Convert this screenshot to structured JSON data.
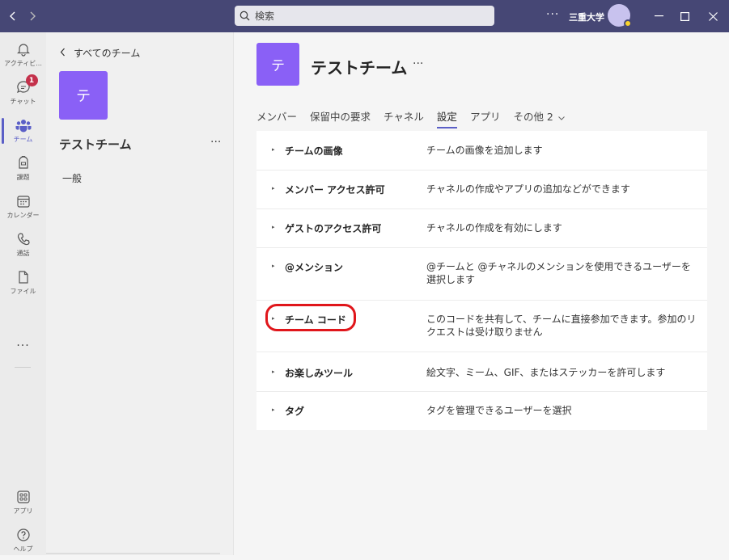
{
  "titlebar": {
    "search_placeholder": "検索",
    "more": "···",
    "org_name": "三重大学",
    "accent": "#464775"
  },
  "rail": {
    "items": [
      {
        "label": "アクティビ...",
        "icon": "bell-icon"
      },
      {
        "label": "チャット",
        "icon": "chat-icon",
        "badge": "1"
      },
      {
        "label": "チーム",
        "icon": "teams-icon"
      },
      {
        "label": "課題",
        "icon": "assignments-icon"
      },
      {
        "label": "カレンダー",
        "icon": "calendar-icon"
      },
      {
        "label": "通話",
        "icon": "phone-icon"
      },
      {
        "label": "ファイル",
        "icon": "file-icon"
      }
    ],
    "more": "···",
    "bottom": [
      {
        "label": "アプリ",
        "icon": "apps-icon"
      },
      {
        "label": "ヘルプ",
        "icon": "help-icon"
      }
    ]
  },
  "panel": {
    "back_label": "すべてのチーム",
    "team_initial": "テ",
    "team_name": "テストチーム",
    "more": "···",
    "channels": [
      "一般"
    ]
  },
  "main": {
    "team_initial": "テ",
    "title": "テストチーム",
    "more": "···",
    "tabs": [
      "メンバー",
      "保留中の要求",
      "チャネル",
      "設定",
      "アプリ",
      "その他 2"
    ],
    "active_tab": "設定",
    "settings": [
      {
        "name": "チームの画像",
        "desc": "チームの画像を追加します"
      },
      {
        "name": "メンバー アクセス許可",
        "desc": "チャネルの作成やアプリの追加などができます"
      },
      {
        "name": "ゲストのアクセス許可",
        "desc": "チャネルの作成を有効にします"
      },
      {
        "name": "@メンション",
        "desc": "@チームと @チャネルのメンションを使用できるユーザーを選択します"
      },
      {
        "name": "チーム コード",
        "desc": "このコードを共有して、チームに直接参加できます。参加のリクエストは受け取りません"
      },
      {
        "name": "お楽しみツール",
        "desc": "絵文字、ミーム、GIF、またはステッカーを許可します"
      },
      {
        "name": "タグ",
        "desc": "タグを管理できるユーザーを選択"
      }
    ],
    "highlight_color": "#e0161b"
  }
}
